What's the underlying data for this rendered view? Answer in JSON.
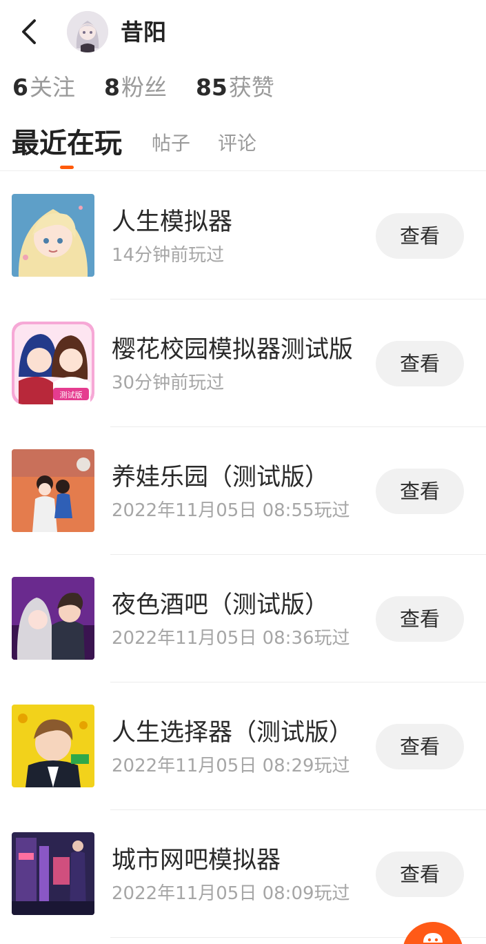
{
  "header": {
    "username": "昔阳"
  },
  "stats": [
    {
      "num": "6",
      "label": "关注"
    },
    {
      "num": "8",
      "label": "粉丝"
    },
    {
      "num": "85",
      "label": "获赞"
    }
  ],
  "tabs": [
    {
      "label": "最近在玩",
      "active": true
    },
    {
      "label": "帖子",
      "active": false
    },
    {
      "label": "评论",
      "active": false
    }
  ],
  "games": [
    {
      "title": "人生模拟器",
      "time": "14分钟前玩过",
      "button": "查看",
      "icon": "game-icon-life-sim"
    },
    {
      "title": "樱花校园模拟器测试版",
      "time": "30分钟前玩过",
      "button": "查看",
      "icon": "game-icon-sakura-school"
    },
    {
      "title": "养娃乐园（测试版）",
      "time": "2022年11月05日 08:55玩过",
      "button": "查看",
      "icon": "game-icon-baby-park"
    },
    {
      "title": "夜色酒吧（测试版）",
      "time": "2022年11月05日 08:36玩过",
      "button": "查看",
      "icon": "game-icon-night-bar"
    },
    {
      "title": "人生选择器（测试版）",
      "time": "2022年11月05日 08:29玩过",
      "button": "查看",
      "icon": "game-icon-life-choice"
    },
    {
      "title": "城市网吧模拟器",
      "time": "2022年11月05日 08:09玩过",
      "button": "查看",
      "icon": "game-icon-internet-cafe"
    }
  ],
  "colors": {
    "accent": "#ff5a0a",
    "fab": "#ff5a17",
    "button_bg": "#f1f1f1",
    "muted_text": "#a6a6a6"
  }
}
